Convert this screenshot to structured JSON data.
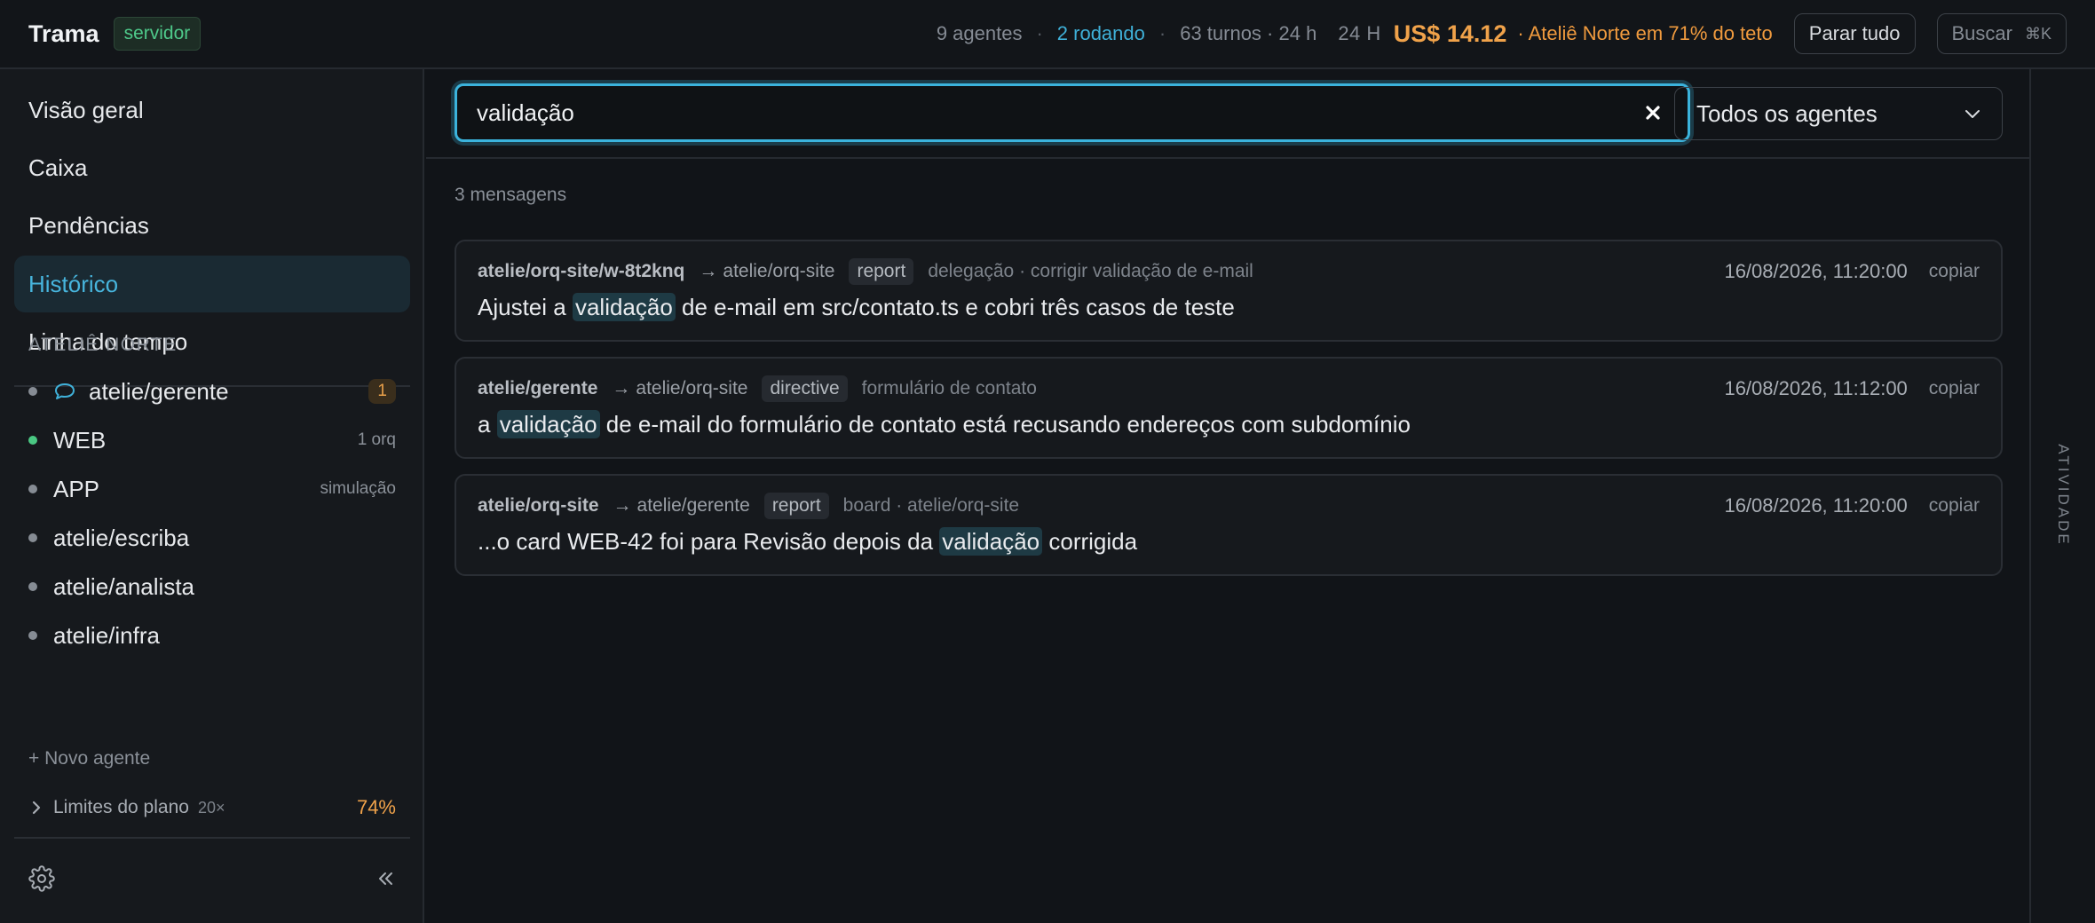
{
  "app": {
    "title": "Trama",
    "env_badge": "servidor"
  },
  "header": {
    "agents": "9 agentes",
    "running": "2 rodando",
    "turns": "63 turnos · 24 h",
    "period": "24 H",
    "cost": "US$ 14.12",
    "warning": "· Ateliê Norte em 71% do teto",
    "stop_all": "Parar tudo",
    "search": "Buscar",
    "search_shortcut": "⌘K"
  },
  "sidebar": {
    "nav": [
      {
        "label": "Visão geral",
        "active": false
      },
      {
        "label": "Caixa",
        "active": false
      },
      {
        "label": "Pendências",
        "active": false
      },
      {
        "label": "Histórico",
        "active": true
      },
      {
        "label": "Linha do tempo",
        "active": false
      }
    ],
    "section_title": "ATELIÊ NORTE",
    "agents": [
      {
        "name": "atelie/gerente",
        "status": "idle",
        "badge": "1",
        "meta": ""
      },
      {
        "name": "WEB",
        "status": "running",
        "badge": "",
        "meta": "1 orq"
      },
      {
        "name": "APP",
        "status": "idle",
        "badge": "",
        "meta": "simulação"
      },
      {
        "name": "atelie/escriba",
        "status": "idle",
        "badge": "",
        "meta": ""
      },
      {
        "name": "atelie/analista",
        "status": "idle",
        "badge": "",
        "meta": ""
      },
      {
        "name": "atelie/infra",
        "status": "idle",
        "badge": "",
        "meta": ""
      }
    ],
    "new_agent": "+ Novo agente",
    "plan_limits": {
      "label": "Limites do plano",
      "multiplier": "20×",
      "percent": "74%"
    }
  },
  "search": {
    "query": "validação",
    "agent_filter": "Todos os agentes",
    "result_count": "3 mensagens"
  },
  "messages": [
    {
      "from": "atelie/orq-site/w-8t2knq",
      "to": "atelie/orq-site",
      "type": "report",
      "context": "delegação · corrigir validação de e-mail",
      "time": "16/08/2026, 11:20:00",
      "copy": "copiar",
      "body_pre": "Ajustei a ",
      "body_match": "validação",
      "body_post": " de e-mail em src/contato.ts e cobri três casos de teste"
    },
    {
      "from": "atelie/gerente",
      "to": "atelie/orq-site",
      "type": "directive",
      "context": "formulário de contato",
      "time": "16/08/2026, 11:12:00",
      "copy": "copiar",
      "body_pre": "a ",
      "body_match": "validação",
      "body_post": " de e-mail do formulário de contato está recusando endereços com subdomínio"
    },
    {
      "from": "atelie/orq-site",
      "to": "atelie/gerente",
      "type": "report",
      "context": "board · atelie/orq-site",
      "time": "16/08/2026, 11:20:00",
      "copy": "copiar",
      "body_pre": "...o card WEB-42 foi para Revisão depois da ",
      "body_match": "validação",
      "body_post": " corrigida"
    }
  ],
  "rail": {
    "label": "ATIVIDADE"
  },
  "colors": {
    "accent": "#3bb3dc",
    "running": "#4ac883",
    "warning": "#f0a24a",
    "highlight": "#1e3a44"
  }
}
